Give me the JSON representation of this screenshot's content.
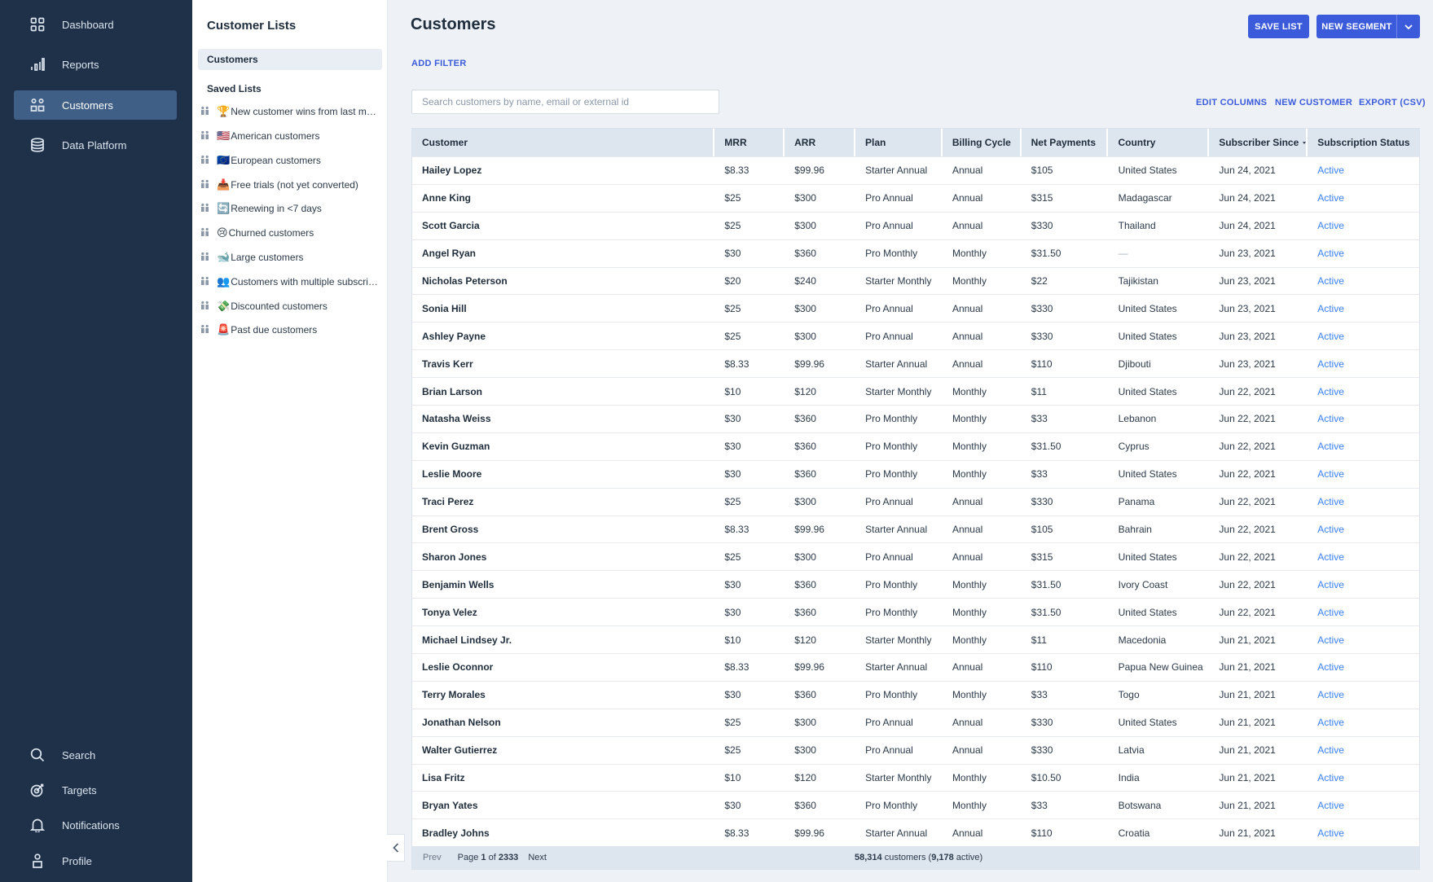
{
  "nav": {
    "top": [
      {
        "label": "Dashboard",
        "icon": "dashboard-icon"
      },
      {
        "label": "Reports",
        "icon": "bar-chart-icon"
      },
      {
        "label": "Customers",
        "icon": "customers-icon",
        "active": true
      },
      {
        "label": "Data Platform",
        "icon": "database-icon"
      }
    ],
    "bottom": [
      {
        "label": "Search",
        "icon": "search-icon"
      },
      {
        "label": "Targets",
        "icon": "target-icon"
      },
      {
        "label": "Notifications",
        "icon": "bell-icon"
      },
      {
        "label": "Profile",
        "icon": "profile-icon"
      }
    ]
  },
  "lists": {
    "title": "Customer Lists",
    "current": "Customers",
    "saved_title": "Saved Lists",
    "saved": [
      {
        "emoji": "🏆",
        "label": "New customer wins from last month"
      },
      {
        "emoji": "🇺🇸",
        "label": "American customers"
      },
      {
        "emoji": "🇪🇺",
        "label": "European customers"
      },
      {
        "emoji": "📥",
        "label": "Free trials (not yet converted)"
      },
      {
        "emoji": "🔄",
        "label": "Renewing in <7 days"
      },
      {
        "emoji": "😢",
        "label": "Churned customers"
      },
      {
        "emoji": "🐋",
        "label": "Large customers"
      },
      {
        "emoji": "👥",
        "label": "Customers with multiple subscriptions"
      },
      {
        "emoji": "💸",
        "label": "Discounted customers"
      },
      {
        "emoji": "🚨",
        "label": "Past due customers"
      }
    ]
  },
  "main": {
    "title": "Customers",
    "save_list": "SAVE LIST",
    "new_segment": "NEW SEGMENT",
    "add_filter": "ADD FILTER",
    "search_placeholder": "Search customers by name, email or external id",
    "edit_columns": "EDIT COLUMNS",
    "new_customer": "NEW CUSTOMER",
    "export_csv": "EXPORT (CSV)"
  },
  "table": {
    "columns": [
      "Customer",
      "MRR",
      "ARR",
      "Plan",
      "Billing Cycle",
      "Net Payments",
      "Country",
      "Subscriber Since",
      "Subscription Status"
    ],
    "rows": [
      [
        "Hailey Lopez",
        "$8.33",
        "$99.96",
        "Starter Annual",
        "Annual",
        "$105",
        "United States",
        "Jun 24, 2021",
        "Active"
      ],
      [
        "Anne King",
        "$25",
        "$300",
        "Pro Annual",
        "Annual",
        "$315",
        "Madagascar",
        "Jun 24, 2021",
        "Active"
      ],
      [
        "Scott Garcia",
        "$25",
        "$300",
        "Pro Annual",
        "Annual",
        "$330",
        "Thailand",
        "Jun 24, 2021",
        "Active"
      ],
      [
        "Angel Ryan",
        "$30",
        "$360",
        "Pro Monthly",
        "Monthly",
        "$31.50",
        "—",
        "Jun 23, 2021",
        "Active"
      ],
      [
        "Nicholas Peterson",
        "$20",
        "$240",
        "Starter Monthly",
        "Monthly",
        "$22",
        "Tajikistan",
        "Jun 23, 2021",
        "Active"
      ],
      [
        "Sonia Hill",
        "$25",
        "$300",
        "Pro Annual",
        "Annual",
        "$330",
        "United States",
        "Jun 23, 2021",
        "Active"
      ],
      [
        "Ashley Payne",
        "$25",
        "$300",
        "Pro Annual",
        "Annual",
        "$330",
        "United States",
        "Jun 23, 2021",
        "Active"
      ],
      [
        "Travis Kerr",
        "$8.33",
        "$99.96",
        "Starter Annual",
        "Annual",
        "$110",
        "Djibouti",
        "Jun 23, 2021",
        "Active"
      ],
      [
        "Brian Larson",
        "$10",
        "$120",
        "Starter Monthly",
        "Monthly",
        "$11",
        "United States",
        "Jun 22, 2021",
        "Active"
      ],
      [
        "Natasha Weiss",
        "$30",
        "$360",
        "Pro Monthly",
        "Monthly",
        "$33",
        "Lebanon",
        "Jun 22, 2021",
        "Active"
      ],
      [
        "Kevin Guzman",
        "$30",
        "$360",
        "Pro Monthly",
        "Monthly",
        "$31.50",
        "Cyprus",
        "Jun 22, 2021",
        "Active"
      ],
      [
        "Leslie Moore",
        "$30",
        "$360",
        "Pro Monthly",
        "Monthly",
        "$33",
        "United States",
        "Jun 22, 2021",
        "Active"
      ],
      [
        "Traci Perez",
        "$25",
        "$300",
        "Pro Annual",
        "Annual",
        "$330",
        "Panama",
        "Jun 22, 2021",
        "Active"
      ],
      [
        "Brent Gross",
        "$8.33",
        "$99.96",
        "Starter Annual",
        "Annual",
        "$105",
        "Bahrain",
        "Jun 22, 2021",
        "Active"
      ],
      [
        "Sharon Jones",
        "$25",
        "$300",
        "Pro Annual",
        "Annual",
        "$315",
        "United States",
        "Jun 22, 2021",
        "Active"
      ],
      [
        "Benjamin Wells",
        "$30",
        "$360",
        "Pro Monthly",
        "Monthly",
        "$31.50",
        "Ivory Coast",
        "Jun 22, 2021",
        "Active"
      ],
      [
        "Tonya Velez",
        "$30",
        "$360",
        "Pro Monthly",
        "Monthly",
        "$31.50",
        "United States",
        "Jun 22, 2021",
        "Active"
      ],
      [
        "Michael Lindsey Jr.",
        "$10",
        "$120",
        "Starter Monthly",
        "Monthly",
        "$11",
        "Macedonia",
        "Jun 21, 2021",
        "Active"
      ],
      [
        "Leslie Oconnor",
        "$8.33",
        "$99.96",
        "Starter Annual",
        "Annual",
        "$110",
        "Papua New Guinea",
        "Jun 21, 2021",
        "Active"
      ],
      [
        "Terry Morales",
        "$30",
        "$360",
        "Pro Monthly",
        "Monthly",
        "$33",
        "Togo",
        "Jun 21, 2021",
        "Active"
      ],
      [
        "Jonathan Nelson",
        "$25",
        "$300",
        "Pro Annual",
        "Annual",
        "$330",
        "United States",
        "Jun 21, 2021",
        "Active"
      ],
      [
        "Walter Gutierrez",
        "$25",
        "$300",
        "Pro Annual",
        "Annual",
        "$330",
        "Latvia",
        "Jun 21, 2021",
        "Active"
      ],
      [
        "Lisa Fritz",
        "$10",
        "$120",
        "Starter Monthly",
        "Monthly",
        "$10.50",
        "India",
        "Jun 21, 2021",
        "Active"
      ],
      [
        "Bryan Yates",
        "$30",
        "$360",
        "Pro Monthly",
        "Monthly",
        "$33",
        "Botswana",
        "Jun 21, 2021",
        "Active"
      ],
      [
        "Bradley Johns",
        "$8.33",
        "$99.96",
        "Starter Annual",
        "Annual",
        "$110",
        "Croatia",
        "Jun 21, 2021",
        "Active"
      ]
    ],
    "footer": {
      "prev": "Prev",
      "page_label": "Page",
      "page": "1",
      "of_label": "of",
      "total_pages": "2333",
      "next": "Next",
      "customers_count": "58,314",
      "customers_label": "customers (",
      "active_count": "9,178",
      "active_label": "active)"
    }
  },
  "colors": {
    "nav_bg": "#1e3149",
    "nav_active": "#3f5f86",
    "primary": "#3b5bdb",
    "status_active": "#3b82f6"
  }
}
